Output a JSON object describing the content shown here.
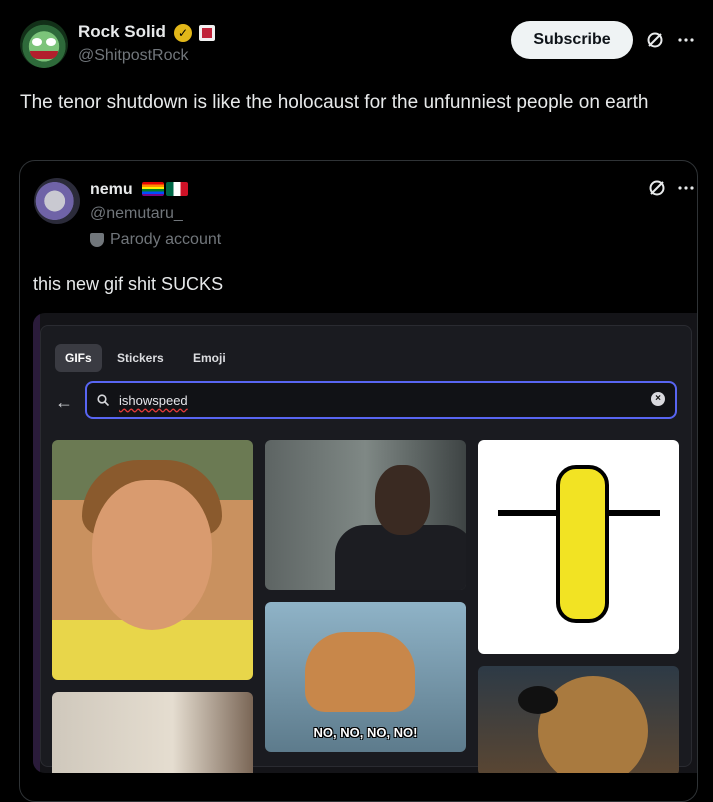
{
  "post": {
    "author_name": "Rock Solid",
    "author_handle": "@ShitpostRock",
    "subscribe_label": "Subscribe",
    "text": "The tenor shutdown is like the holocaust for the unfunniest people on earth"
  },
  "quote": {
    "author_name": "nemu",
    "author_handle": "@nemutaru_",
    "account_label": "Parody account",
    "text": "this new gif shit SUCKS"
  },
  "gif_picker": {
    "tabs": [
      {
        "label": "GIFs",
        "active": true
      },
      {
        "label": "Stickers",
        "active": false
      },
      {
        "label": "Emoji",
        "active": false
      }
    ],
    "search_value": "ishowspeed",
    "results": [
      {
        "name": "kid-smile"
      },
      {
        "name": "office-man"
      },
      {
        "name": "dancing-banana"
      },
      {
        "name": "bambi",
        "caption": "NO, NO, NO, NO!"
      },
      {
        "name": "hand-wave"
      },
      {
        "name": "dug-dog"
      }
    ]
  },
  "colors": {
    "background": "#000000",
    "accent_border": "#5865f2",
    "verified": "#e2b719"
  },
  "icons": [
    "verified-badge-icon",
    "grok-icon",
    "more-icon",
    "back-arrow-icon",
    "search-icon",
    "clear-icon",
    "parody-mask-icon"
  ]
}
